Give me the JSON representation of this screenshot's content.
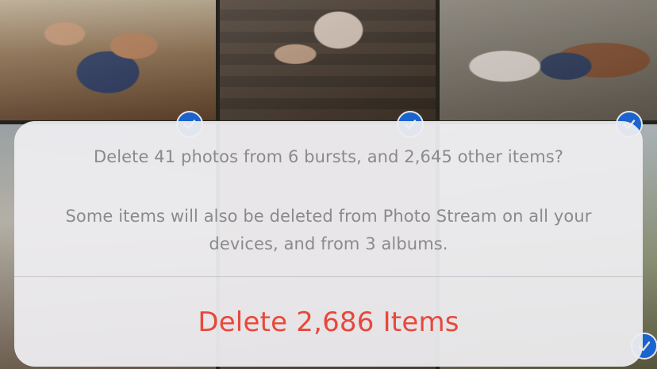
{
  "photos": [
    {
      "name": "photo-1"
    },
    {
      "name": "photo-2"
    },
    {
      "name": "photo-3"
    },
    {
      "name": "photo-4"
    },
    {
      "name": "photo-5"
    },
    {
      "name": "photo-6"
    }
  ],
  "selection_icon": "checkmark-icon",
  "colors": {
    "destructive": "#e8483b",
    "message_text": "#8a8a8e",
    "selection": "#1f6fe5"
  },
  "alert": {
    "title": "Delete 41 photos from 6 bursts, and 2,645 other items?",
    "message": "Some items will also be deleted from Photo Stream on all your devices, and from 3 albums.",
    "delete_label": "Delete 2,686 Items"
  }
}
